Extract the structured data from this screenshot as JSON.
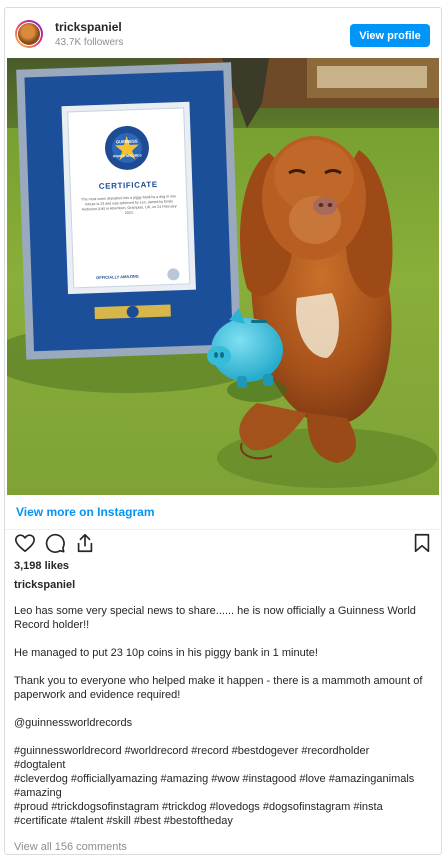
{
  "header": {
    "username": "trickspaniel",
    "followers": "43.7K followers",
    "view_profile_label": "View profile"
  },
  "post": {
    "certificate": {
      "logo_line1": "GUINNESS",
      "logo_line2": "WORLD RECORDS",
      "heading": "CERTIFICATE",
      "body": "The most coins deposited into a piggy bank by a dog in one minute is 23 and was achieved by Leo, owned by Emily Anderson (UK) in Aberdeen, Grampian, UK, on 24 February 2023.",
      "footer": "OFFICIALLY AMAZING"
    },
    "view_more_label": "View more on Instagram",
    "likes": "3,198 likes",
    "owner": "trickspaniel",
    "caption": {
      "p1": "Leo has some very special news to share...... he is now officially a Guinness World Record holder!!",
      "p2": "He managed to put 23 10p coins in his piggy bank in 1 minute!",
      "p3": "Thank you to everyone who helped make it happen - there is a mammoth amount of paperwork and evidence required!",
      "p4": "@guinnessworldrecords",
      "tags1": "#guinnessworldrecord #worldrecord #record #bestdogever #recordholder",
      "tags2": "#dogtalent",
      "tags3": "#cleverdog #officiallyamazing #amazing #wow #instagood #love #amazinganimals",
      "tags4": "#amazing",
      "tags5": "#proud #trickdogsofinstagram #trickdog #lovedogs #dogsofinstagram #insta",
      "tags6": "#certificate #talent #skill #best #bestoftheday"
    },
    "comments_label": "View all 156 comments"
  },
  "icons": {
    "like": "heart-icon",
    "comment": "comment-icon",
    "share": "share-icon",
    "save": "bookmark-icon"
  },
  "colors": {
    "accent": "#0095f6",
    "text": "#262626",
    "muted": "#8e8e8e",
    "border": "#dbdbdb"
  }
}
